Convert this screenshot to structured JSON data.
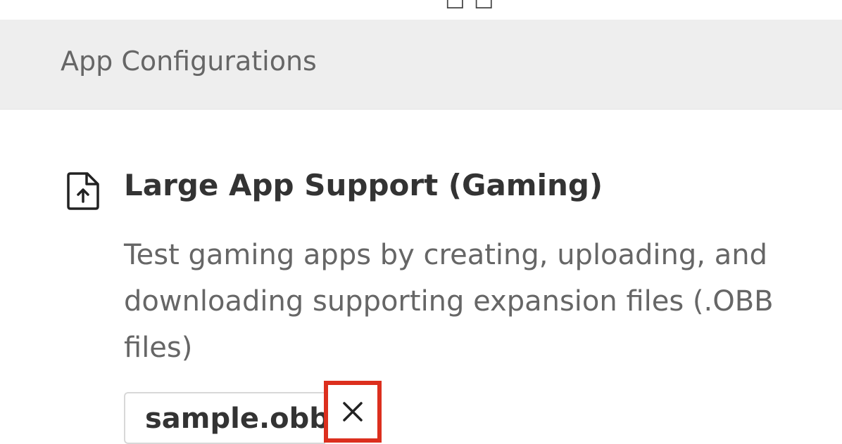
{
  "section": {
    "title": "App Configurations"
  },
  "feature": {
    "icon": "file-upload-icon",
    "title": "Large App Support (Gaming)",
    "description": "Test gaming apps by creating, uploading, and downloading supporting expansion files (.OBB files)"
  },
  "uploaded_file": {
    "name": "sample.obb",
    "remove_icon": "close-icon"
  },
  "colors": {
    "header_background": "#eeeeee",
    "highlight_border": "#dc2f1e",
    "title_text": "#333333",
    "secondary_text": "#666666"
  }
}
